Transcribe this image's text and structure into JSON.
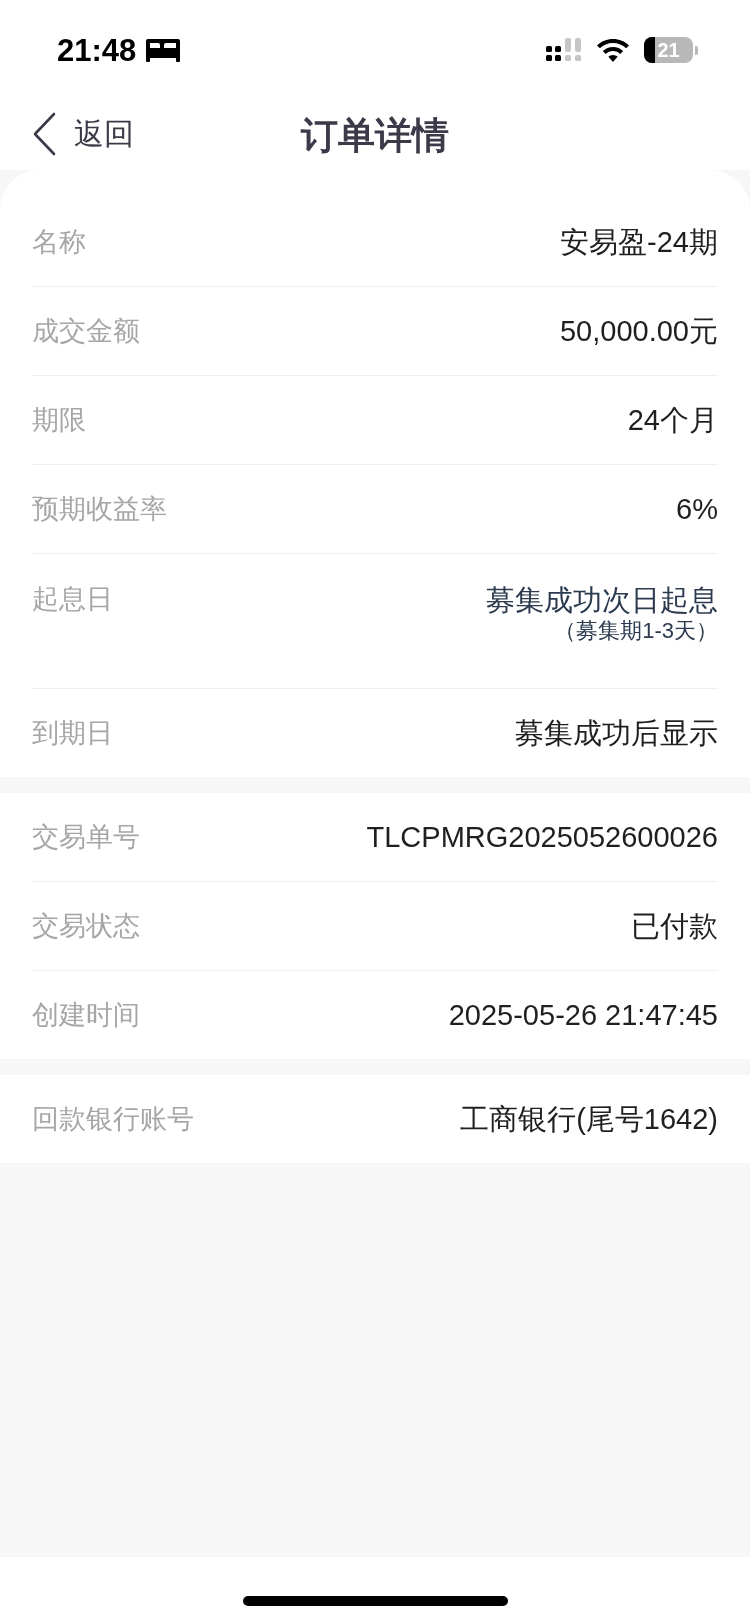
{
  "status_bar": {
    "time": "21:48",
    "battery": "21"
  },
  "nav": {
    "back": "返回",
    "title": "订单详情"
  },
  "sections": [
    {
      "rows": [
        {
          "label": "名称",
          "value": "安易盈-24期"
        },
        {
          "label": "成交金额",
          "value": "50,000.00元"
        },
        {
          "label": "期限",
          "value": "24个月"
        },
        {
          "label": "预期收益率",
          "value": "6%"
        },
        {
          "label": "起息日",
          "value": "募集成功次日起息",
          "note": "（募集期1-3天）"
        },
        {
          "label": "到期日",
          "value": "募集成功后显示"
        }
      ]
    },
    {
      "rows": [
        {
          "label": "交易单号",
          "value": "TLCPMRG2025052600026"
        },
        {
          "label": "交易状态",
          "value": "已付款"
        },
        {
          "label": "创建时间",
          "value": "2025-05-26 21:47:45"
        }
      ]
    },
    {
      "rows": [
        {
          "label": "回款银行账号",
          "value": "工商银行(尾号1642)"
        }
      ]
    }
  ]
}
